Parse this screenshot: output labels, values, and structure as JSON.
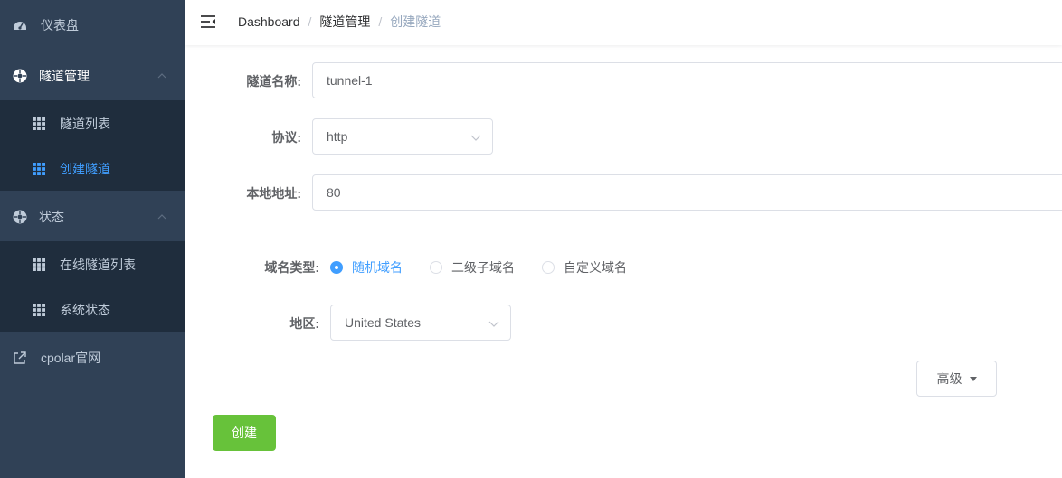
{
  "sidebar": {
    "dashboard": "仪表盘",
    "tunnel_mgmt": "隧道管理",
    "tunnel_list": "隧道列表",
    "create_tunnel": "创建隧道",
    "status": "状态",
    "online_tunnels": "在线隧道列表",
    "system_status": "系统状态",
    "cpolar_site": "cpolar官网"
  },
  "breadcrumb": {
    "items": [
      "Dashboard",
      "隧道管理",
      "创建隧道"
    ],
    "separator": "/"
  },
  "form": {
    "name_label": "隧道名称:",
    "name_value": "tunnel-1",
    "protocol_label": "协议:",
    "protocol_value": "http",
    "local_label": "本地地址:",
    "local_value": "80",
    "domain_type_label": "域名类型:",
    "domain_types": [
      "随机域名",
      "二级子域名",
      "自定义域名"
    ],
    "domain_type_selected": 0,
    "region_label": "地区:",
    "region_value": "United States",
    "advanced_label": "高级",
    "create_label": "创建"
  },
  "colors": {
    "sidebar_bg": "#304156",
    "submenu_bg": "#1f2d3d",
    "active": "#409eff",
    "create_button": "#67c23a"
  }
}
